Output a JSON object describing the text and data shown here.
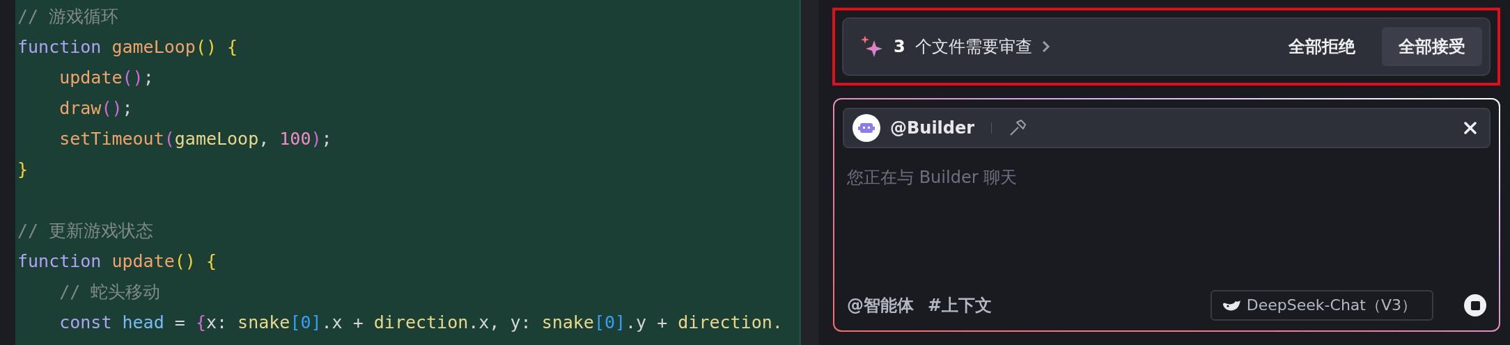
{
  "editor": {
    "lines": [
      [
        {
          "kind": "comment",
          "text": "// 游戏循环"
        }
      ],
      [
        {
          "kind": "keyword",
          "text": "function "
        },
        {
          "kind": "func",
          "text": "gameLoop"
        },
        {
          "kind": "paren",
          "text": "() {"
        }
      ],
      [
        {
          "kind": "func",
          "text": "    update"
        },
        {
          "kind": "paren2",
          "text": "()"
        },
        {
          "kind": "punct",
          "text": ";"
        }
      ],
      [
        {
          "kind": "func",
          "text": "    draw"
        },
        {
          "kind": "paren2",
          "text": "()"
        },
        {
          "kind": "punct",
          "text": ";"
        }
      ],
      [
        {
          "kind": "func",
          "text": "    setTimeout"
        },
        {
          "kind": "paren2",
          "text": "("
        },
        {
          "kind": "ident",
          "text": "gameLoop"
        },
        {
          "kind": "punct",
          "text": ", "
        },
        {
          "kind": "number",
          "text": "100"
        },
        {
          "kind": "paren2",
          "text": ")"
        },
        {
          "kind": "punct",
          "text": ";"
        }
      ],
      [
        {
          "kind": "paren",
          "text": "}"
        }
      ],
      {
        "kind": "blank"
      },
      [
        {
          "kind": "comment",
          "text": "// 更新游戏状态"
        }
      ],
      [
        {
          "kind": "keyword",
          "text": "function "
        },
        {
          "kind": "func",
          "text": "update"
        },
        {
          "kind": "paren",
          "text": "() {"
        }
      ],
      [
        {
          "kind": "comment",
          "text": "    // 蛇头移动"
        }
      ],
      [
        {
          "kind": "keyword",
          "text": "    const "
        },
        {
          "kind": "variable",
          "text": "head"
        },
        {
          "kind": "punct",
          "text": " = "
        },
        {
          "kind": "paren2",
          "text": "{"
        },
        {
          "kind": "punct",
          "text": "x: "
        },
        {
          "kind": "ident",
          "text": "snake"
        },
        {
          "kind": "bracket",
          "text": "[0]"
        },
        {
          "kind": "punct",
          "text": ".x + "
        },
        {
          "kind": "ident",
          "text": "direction"
        },
        {
          "kind": "punct",
          "text": ".x, y: "
        },
        {
          "kind": "ident",
          "text": "snake"
        },
        {
          "kind": "bracket",
          "text": "[0]"
        },
        {
          "kind": "punct",
          "text": ".y + "
        },
        {
          "kind": "ident",
          "text": "direction."
        }
      ]
    ]
  },
  "review_bar": {
    "count": "3",
    "label": "个文件需要审查",
    "buttons": [
      {
        "label": "全部拒绝",
        "kind": "text"
      },
      {
        "label": "全部接受",
        "kind": "filled"
      }
    ]
  },
  "chat": {
    "agent": "@Builder",
    "placeholder": "您正在与 Builder 聊天",
    "tools": [
      "@智能体",
      "#上下文"
    ],
    "model": "DeepSeek-Chat（V3）"
  }
}
